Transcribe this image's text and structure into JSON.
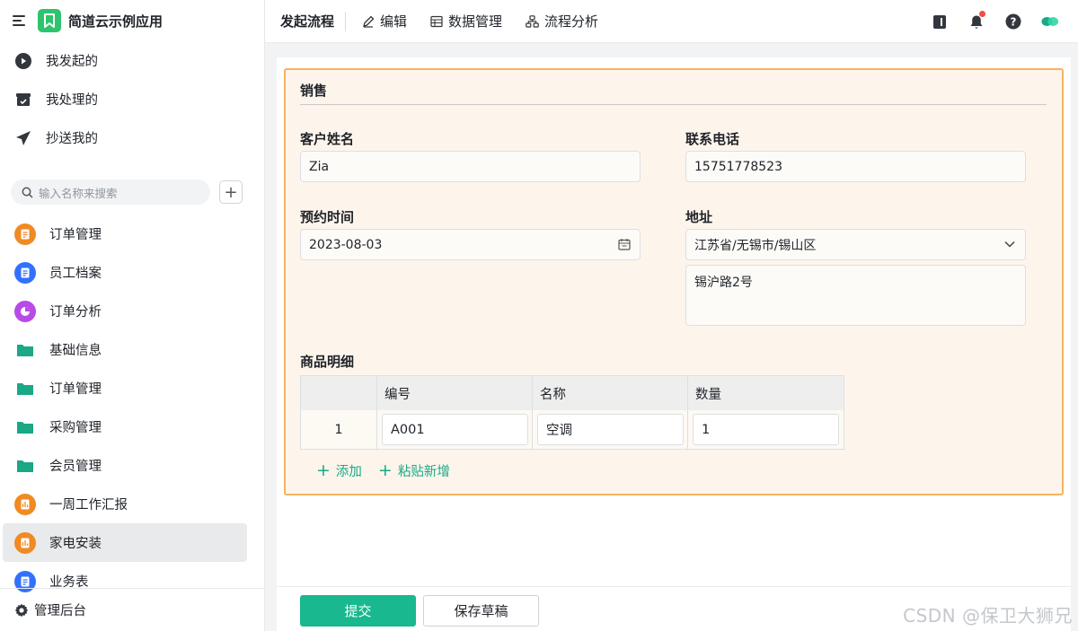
{
  "app": {
    "title": "简道云示例应用"
  },
  "nav_top": [
    {
      "label": "我发起的",
      "icon": "play-circle-icon"
    },
    {
      "label": "我处理的",
      "icon": "inbox-check-icon"
    },
    {
      "label": "抄送我的",
      "icon": "paper-plane-icon"
    }
  ],
  "search": {
    "placeholder": "输入名称来搜索",
    "add_label": "+"
  },
  "nav_items": [
    {
      "label": "订单管理",
      "icon": "form-icon",
      "color": "#f08a24"
    },
    {
      "label": "员工档案",
      "icon": "form-icon",
      "color": "#3370ff"
    },
    {
      "label": "订单分析",
      "icon": "pie-chart-icon",
      "color": "#b84ae8"
    },
    {
      "label": "基础信息",
      "icon": "folder-icon",
      "color": "#1aa887"
    },
    {
      "label": "订单管理",
      "icon": "folder-icon",
      "color": "#1aa887"
    },
    {
      "label": "采购管理",
      "icon": "folder-icon",
      "color": "#1aa887"
    },
    {
      "label": "会员管理",
      "icon": "folder-icon",
      "color": "#1aa887"
    },
    {
      "label": "一周工作汇报",
      "icon": "report-icon",
      "color": "#f08a24"
    },
    {
      "label": "家电安装",
      "icon": "report-icon",
      "color": "#f08a24",
      "active": true
    },
    {
      "label": "业务表",
      "icon": "form-icon",
      "color": "#3370ff"
    }
  ],
  "sidebar_footer": {
    "label": "管理后台"
  },
  "topbar": {
    "tabs": [
      "发起流程",
      "编辑",
      "数据管理",
      "流程分析"
    ]
  },
  "form": {
    "section_title": "销售",
    "customer_name": {
      "label": "客户姓名",
      "value": "Zia"
    },
    "phone": {
      "label": "联系电话",
      "value": "15751778523"
    },
    "appointment": {
      "label": "预约时间",
      "value": "2023-08-03"
    },
    "address": {
      "label": "地址",
      "region": "江苏省/无锡市/锡山区",
      "detail": "锡沪路2号"
    },
    "items": {
      "label": "商品明细",
      "columns": [
        "编号",
        "名称",
        "数量"
      ],
      "rows": [
        {
          "index": "1",
          "code": "A001",
          "name": "空调",
          "qty": "1"
        }
      ],
      "add_label": "添加",
      "paste_label": "粘贴新增"
    }
  },
  "footer": {
    "submit_label": "提交",
    "draft_label": "保存草稿"
  },
  "watermark": "CSDN @保卫大狮兄",
  "colors": {
    "accent": "#19b88f",
    "card_border": "#f5b35f",
    "card_bg": "#fdf5ec"
  }
}
